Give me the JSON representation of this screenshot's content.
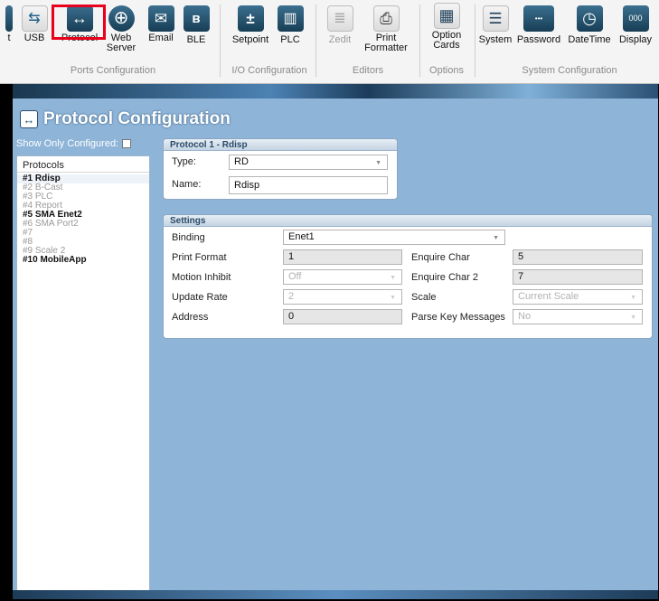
{
  "ribbon": {
    "ports": [
      {
        "label": "USB",
        "icon": "usb-icon",
        "glyph": "⇆"
      },
      {
        "label": "Protocol",
        "icon": "protocol-icon",
        "glyph": "↔"
      },
      {
        "label": "Web\nServer",
        "icon": "globe-icon",
        "glyph": "⊕"
      },
      {
        "label": "Email",
        "icon": "envelope-icon",
        "glyph": "✉"
      },
      {
        "label": "BLE",
        "icon": "bluetooth-icon",
        "glyph": "ʙ"
      }
    ],
    "io": [
      {
        "label": "Setpoint",
        "icon": "setpoint-icon",
        "glyph": "±"
      },
      {
        "label": "PLC",
        "icon": "plc-icon",
        "glyph": "▥"
      }
    ],
    "editors": [
      {
        "label": "Zedit",
        "icon": "zedit-icon",
        "glyph": "≣",
        "disabled": true
      },
      {
        "label": "Print\nFormatter",
        "icon": "print-formatter-icon",
        "glyph": "⎙"
      }
    ],
    "options": [
      {
        "label": "Option\nCards",
        "icon": "option-cards-icon",
        "glyph": "▦"
      }
    ],
    "system": [
      {
        "label": "System",
        "icon": "sliders-icon",
        "glyph": "☰"
      },
      {
        "label": "Password",
        "icon": "password-icon",
        "glyph": "•••"
      },
      {
        "label": "DateTime",
        "icon": "clock-icon",
        "glyph": "◷"
      },
      {
        "label": "Display",
        "icon": "display-icon",
        "glyph": "000"
      }
    ],
    "group_labels": {
      "ports": "Ports Configuration",
      "io": "I/O Configuration",
      "editors": "Editors",
      "options": "Options",
      "system": "System Configuration"
    }
  },
  "page": {
    "title": "Protocol Configuration",
    "show_only_configured": "Show Only Configured:"
  },
  "protocols": {
    "header": "Protocols",
    "items": [
      {
        "label": "#1 Rdisp",
        "state": "selected"
      },
      {
        "label": "#2 B-Cast",
        "state": "off"
      },
      {
        "label": "#3 PLC",
        "state": "off"
      },
      {
        "label": "#4 Report",
        "state": "off"
      },
      {
        "label": "#5 SMA Enet2",
        "state": "on"
      },
      {
        "label": "#6 SMA Port2",
        "state": "off"
      },
      {
        "label": "#7",
        "state": "off"
      },
      {
        "label": "#8",
        "state": "off"
      },
      {
        "label": "#9 Scale 2",
        "state": "off"
      },
      {
        "label": "#10 MobileApp",
        "state": "on"
      }
    ]
  },
  "protocol_panel": {
    "title": "Protocol 1 - Rdisp",
    "type_label": "Type:",
    "type_value": "RD",
    "name_label": "Name:",
    "name_value": "Rdisp"
  },
  "settings": {
    "title": "Settings",
    "binding_label": "Binding",
    "binding_value": "Enet1",
    "print_format_label": "Print Format",
    "print_format_value": "1",
    "enquire_char_label": "Enquire Char",
    "enquire_char_value": "5",
    "motion_inhibit_label": "Motion Inhibit",
    "motion_inhibit_value": "Off",
    "enquire_char2_label": "Enquire Char 2",
    "enquire_char2_value": "7",
    "update_rate_label": "Update Rate",
    "update_rate_value": "2",
    "scale_label": "Scale",
    "scale_value": "Current Scale",
    "address_label": "Address",
    "address_value": "0",
    "parse_key_label": "Parse Key Messages",
    "parse_key_value": "No"
  },
  "colors": {
    "highlight": "#e8001c",
    "workspace": "#8eb4d8",
    "panel_header": "#2a4a68"
  }
}
